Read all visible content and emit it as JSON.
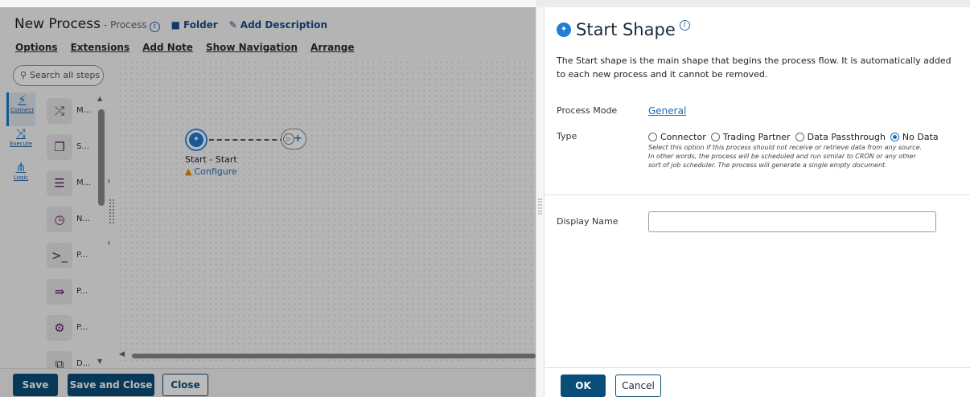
{
  "editor": {
    "title": "New Process",
    "subtitle": "- Process",
    "folder_label": "Folder",
    "add_description_label": "Add Description",
    "menu": [
      "Options",
      "Extensions",
      "Add Note",
      "Show Navigation",
      "Arrange"
    ],
    "search_placeholder": "Search all steps",
    "categories": [
      {
        "label": "Connect",
        "icon": "connect-icon"
      },
      {
        "label": "Execute",
        "icon": "execute-icon"
      },
      {
        "label": "Logic",
        "icon": "logic-icon"
      }
    ],
    "steps": [
      {
        "label": "M...",
        "icon": "shuffle-icon"
      },
      {
        "label": "S...",
        "icon": "set-properties-icon"
      },
      {
        "label": "M...",
        "icon": "message-icon"
      },
      {
        "label": "N...",
        "icon": "notify-icon"
      },
      {
        "label": "P...",
        "icon": "program-command-icon"
      },
      {
        "label": "P...",
        "icon": "process-call-icon"
      },
      {
        "label": "P...",
        "icon": "process-route-icon"
      },
      {
        "label": "D...",
        "icon": "data-process-icon"
      }
    ],
    "canvas": {
      "start_label": "Start - Start",
      "configure_label": "Configure"
    },
    "buttons": {
      "save": "Save",
      "save_close": "Save and Close",
      "close": "Close"
    }
  },
  "panel": {
    "title": "Start Shape",
    "description": "The Start shape is the main shape that begins the process flow. It is automatically added to each new process and it cannot be removed.",
    "process_mode_label": "Process Mode",
    "process_mode_value": "General",
    "type_label": "Type",
    "type_options": [
      "Connector",
      "Trading Partner",
      "Data Passthrough",
      "No Data"
    ],
    "type_selected": "No Data",
    "type_help": "Select this option if this process should not receive or retrieve data from any source. In other words, the process will be scheduled and run similar to CRON or any other sort of job scheduler. The process will generate a single empty document.",
    "display_name_label": "Display Name",
    "display_name_value": "",
    "ok_label": "OK",
    "cancel_label": "Cancel"
  },
  "colors": {
    "primary": "#0b4d79",
    "link": "#1b6ab5",
    "accent_blue": "#1f7fd6",
    "warning": "#d98b00"
  }
}
